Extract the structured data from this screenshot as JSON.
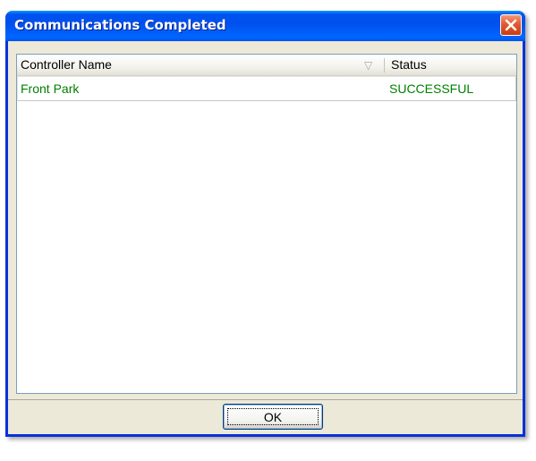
{
  "window": {
    "title": "Communications Completed",
    "close_icon": "close-icon",
    "colors": {
      "title_bar": "#0054e3",
      "close_button": "#e3582f",
      "success_text": "#008000",
      "dialog_face": "#ece9d8"
    }
  },
  "list": {
    "columns": [
      {
        "label": "Controller Name",
        "sort_icon": "sort-descending-icon",
        "sort_glyph": "▽"
      },
      {
        "label": "Status"
      }
    ],
    "rows": [
      {
        "controller_name": "Front Park",
        "status": "SUCCESSFUL"
      }
    ]
  },
  "buttons": {
    "ok_label": "OK"
  }
}
